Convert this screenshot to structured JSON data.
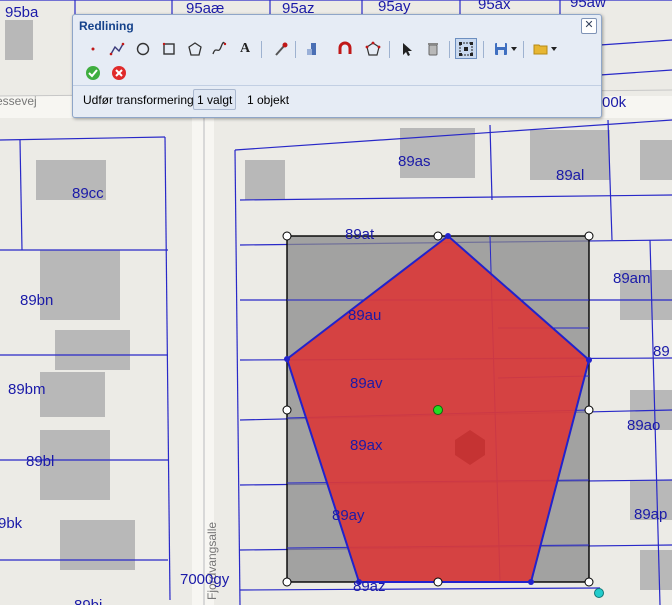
{
  "toolbar": {
    "title": "Redlining",
    "close_glyph": "✕",
    "tools": [
      {
        "icon": "point-draw-icon"
      },
      {
        "icon": "line-draw-icon"
      },
      {
        "icon": "circle-draw-icon"
      },
      {
        "icon": "rectangle-draw-icon"
      },
      {
        "icon": "polygon-draw-icon"
      },
      {
        "icon": "freehand-draw-icon"
      },
      {
        "icon": "text-tool-icon"
      },
      {
        "icon": "color-picker-icon"
      },
      {
        "icon": "measure-icon"
      },
      {
        "icon": "magnet-snap-icon"
      },
      {
        "icon": "polygon-edit-icon"
      },
      {
        "icon": "select-arrow-icon"
      },
      {
        "icon": "delete-bin-icon"
      },
      {
        "icon": "transform-icon"
      },
      {
        "icon": "save-floppy-icon"
      },
      {
        "icon": "open-folder-icon"
      }
    ],
    "text_tool_glyph": "A",
    "confirm_icon": "check-circle-icon",
    "cancel_icon": "cancel-circle-icon",
    "status": {
      "action_label": "Udfør transformering",
      "selected": "1 valgt",
      "objects": "1 objekt"
    }
  },
  "map": {
    "street_label": "essevej",
    "vertical_street_label": "Fjordvangsalle",
    "parcels": [
      "95ba",
      "95aæ",
      "95az",
      "95ay",
      "95ax",
      "95aw",
      "00k",
      "89as",
      "89al",
      "89cc",
      "89at",
      "89am",
      "89bn",
      "89au",
      "89",
      "89bm",
      "89av",
      "89ao",
      "89bl",
      "89ax",
      "9bk",
      "89ay",
      "89ap",
      "7000gy",
      "89az",
      "89bi"
    ],
    "colors": {
      "polygon_fill": "#d93a3a",
      "polygon_stroke": "#2222cc",
      "label": "#1a1aa8",
      "center_handle": "#22dd22",
      "rotate_handle": "#22cccc"
    }
  }
}
